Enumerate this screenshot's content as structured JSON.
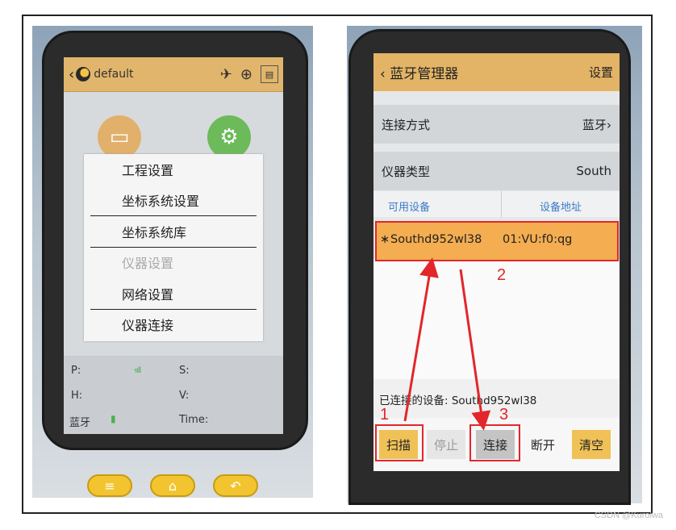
{
  "left": {
    "header": {
      "back": "‹",
      "title": "default"
    },
    "menu": [
      "工程设置",
      "坐标系统设置",
      "坐标系统库",
      "仪器设置",
      "网络设置",
      "仪器连接"
    ],
    "status": {
      "p": "P:",
      "s": "S:",
      "h": "H:",
      "v": "V:",
      "bt": "蓝牙",
      "time": "Time:",
      "signal": "·ııll"
    }
  },
  "right": {
    "header": {
      "title": "‹ 蓝牙管理器",
      "settings": "设置"
    },
    "rows": [
      {
        "label": "连接方式",
        "value": "蓝牙›"
      },
      {
        "label": "仪器类型",
        "value": "South"
      }
    ],
    "table": {
      "col1": "可用设备",
      "col2": "设备地址"
    },
    "device": {
      "bt_icon": "∗",
      "name": "Southd952wl38",
      "address": "01:VU:f0:qg"
    },
    "connected": "已连接的设备: Southd952wl38",
    "buttons": [
      "扫描",
      "停止",
      "连接",
      "断开",
      "清空"
    ]
  },
  "annotations": [
    "1",
    "2",
    "3"
  ],
  "watermark": "CSDN @Kurolwa",
  "colors": {
    "accent": "#e3b466",
    "selected": "#f4ad50",
    "annotation": "#e2262a"
  }
}
